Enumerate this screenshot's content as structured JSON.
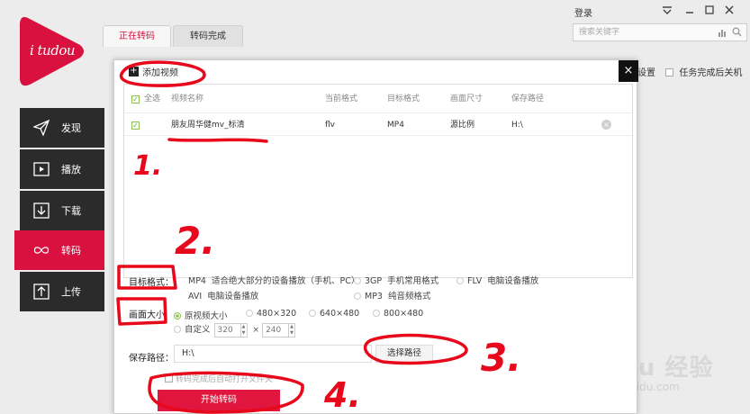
{
  "app": {
    "logo_text": "i tudou",
    "brand_color": "#d9113f",
    "login_label": "登录",
    "search_placeholder": "搜索关键字"
  },
  "tabs": [
    {
      "label": "正在转码",
      "active": true
    },
    {
      "label": "转码完成",
      "active": false
    }
  ],
  "sidebar": {
    "items": [
      {
        "label": "发现",
        "icon": "send-icon"
      },
      {
        "label": "播放",
        "icon": "play-icon"
      },
      {
        "label": "下载",
        "icon": "download-icon"
      },
      {
        "label": "转码",
        "icon": "infinity-icon",
        "active": true
      },
      {
        "label": "上传",
        "icon": "upload-icon"
      }
    ]
  },
  "right_options": {
    "settings_fragment": "设置",
    "shutdown_label": "任务完成后关机"
  },
  "dialog": {
    "add_video_label": "添加视频",
    "close_glyph": "×",
    "columns": {
      "select_all": "全选",
      "name": "视频名称",
      "current_format": "当前格式",
      "target_format": "目标格式",
      "frame_size": "画面尺寸",
      "save_path": "保存路径"
    },
    "rows": [
      {
        "name": "朋友周华健mv_标清",
        "current_format": "flv",
        "target_format": "MP4",
        "frame_size": "源比例",
        "save_path": "H:\\"
      }
    ],
    "target_format": {
      "label": "目标格式：",
      "options": [
        {
          "name": "MP4",
          "desc": "适合绝大部分的设备播放（手机、PC）"
        },
        {
          "name": "3GP",
          "desc": "手机常用格式"
        },
        {
          "name": "FLV",
          "desc": "电脑设备播放"
        },
        {
          "name": "AVI",
          "desc": "电脑设备播放"
        },
        {
          "name": "MP3",
          "desc": "纯音频格式"
        }
      ]
    },
    "frame_size": {
      "label": "画面大小",
      "options": [
        "原视频大小",
        "480×320",
        "640×480",
        "800×480"
      ],
      "selected": "原视频大小",
      "custom_label": "自定义",
      "custom_width": "320",
      "custom_height": "240",
      "times": "×"
    },
    "save": {
      "label": "保存路径：",
      "value": "H:\\",
      "choose_button": "选择路径"
    },
    "after_option": "转码完成后自动打开文件夹",
    "start_button": "开始转码"
  },
  "annotations": [
    "1.",
    "2.",
    "3.",
    "4."
  ],
  "watermark": {
    "main": "Baidu 经验",
    "sub": "jingyan.baidu.com"
  }
}
